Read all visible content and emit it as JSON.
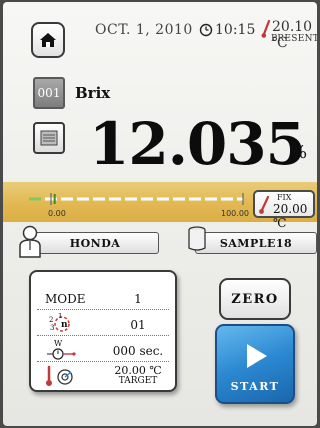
{
  "header": {
    "date": "OCT. 1, 2010",
    "time": "10:15",
    "present_temp": "20.10 ℃",
    "present_label": "PRESENT",
    "icons": {
      "home": "home-icon",
      "clock": "clock-icon",
      "thermometer": "thermometer-icon"
    }
  },
  "measurement": {
    "channel": "001",
    "scale": "Brix",
    "value": "12.035",
    "unit": "%"
  },
  "temperature_bar": {
    "min_label": "0.00",
    "max_label": "100.00",
    "fill_fraction": 0.12,
    "fix_label": "FIX",
    "fix_value": "20.00 ℃"
  },
  "user": {
    "name": "HONDA"
  },
  "sample": {
    "name": "SAMPLE18"
  },
  "conditions": {
    "mode_label": "MODE",
    "mode_value": "1",
    "repeat_value": "01",
    "wait_value": "000 sec.",
    "target_temp": "20.00 ℃",
    "target_label": "TARGET"
  },
  "buttons": {
    "zero": "ZERO",
    "start": "START"
  },
  "colors": {
    "accent_blue": "#2b88d0",
    "band_gold": "#e2b853",
    "bar_green": "#7fc95a",
    "thermo_red": "#c0393b"
  }
}
